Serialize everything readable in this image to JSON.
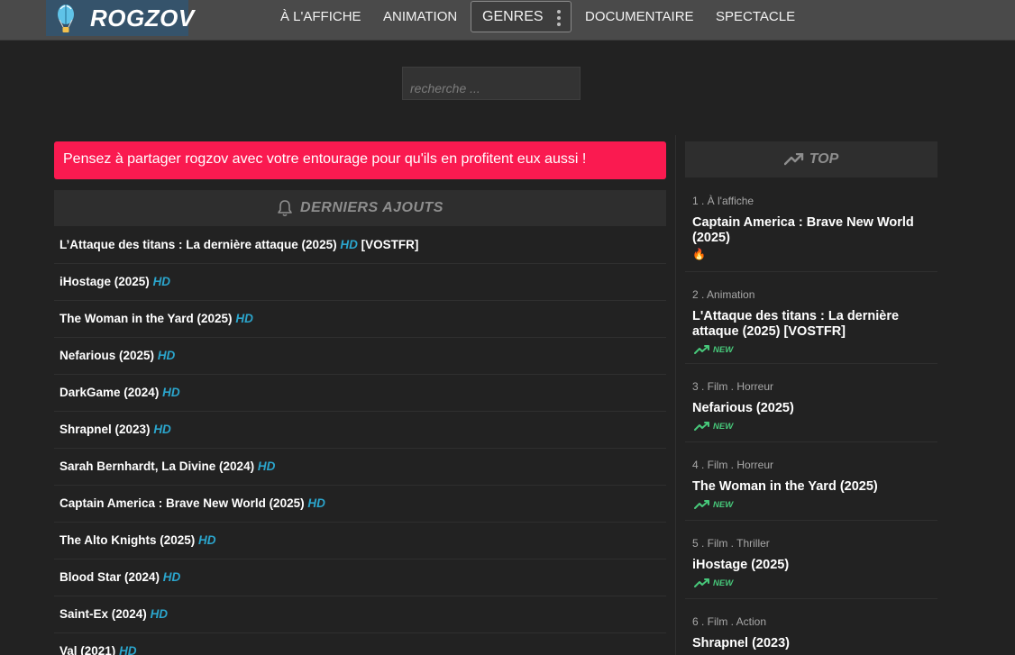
{
  "logo": {
    "text": "ROGZOV"
  },
  "nav": {
    "items": [
      "À L'AFFICHE",
      "ANIMATION",
      "DOCUMENTAIRE",
      "SPECTACLE"
    ],
    "genres_label": "GENRES"
  },
  "search": {
    "placeholder": "recherche ..."
  },
  "alert": {
    "text": "Pensez à partager rogzov avec votre entourage pour qu'ils en profitent eux aussi !"
  },
  "latest": {
    "title": "DERNIERS AJOUTS",
    "items": [
      {
        "title": "L’Attaque des titans : La dernière attaque (2025)",
        "quality": "HD",
        "extra": "[VOSTFR]"
      },
      {
        "title": "iHostage (2025)",
        "quality": "HD",
        "extra": ""
      },
      {
        "title": "The Woman in the Yard (2025)",
        "quality": "HD",
        "extra": ""
      },
      {
        "title": "Nefarious (2025)",
        "quality": "HD",
        "extra": ""
      },
      {
        "title": "DarkGame (2024)",
        "quality": "HD",
        "extra": ""
      },
      {
        "title": "Shrapnel (2023)",
        "quality": "HD",
        "extra": ""
      },
      {
        "title": "Sarah Bernhardt, La Divine (2024)",
        "quality": "HD",
        "extra": ""
      },
      {
        "title": "Captain America : Brave New World (2025)",
        "quality": "HD",
        "extra": ""
      },
      {
        "title": "The Alto Knights (2025)",
        "quality": "HD",
        "extra": ""
      },
      {
        "title": "Blood Star (2024)",
        "quality": "HD",
        "extra": ""
      },
      {
        "title": "Saint-Ex (2024)",
        "quality": "HD",
        "extra": ""
      },
      {
        "title": "Val (2021)",
        "quality": "HD",
        "extra": ""
      }
    ]
  },
  "top": {
    "title": "TOP",
    "items": [
      {
        "category": "1 . À l'affiche",
        "title": "Captain America : Brave New World (2025)",
        "badge": "fire",
        "badge_text": "🔥"
      },
      {
        "category": "2 . Animation",
        "title": "L'Attaque des titans : La dernière attaque (2025) [VOSTFR]",
        "badge": "new",
        "badge_text": "NEW"
      },
      {
        "category": "3 . Film . Horreur",
        "title": "Nefarious (2025)",
        "badge": "new",
        "badge_text": "NEW"
      },
      {
        "category": "4 . Film . Horreur",
        "title": "The Woman in the Yard (2025)",
        "badge": "new",
        "badge_text": "NEW"
      },
      {
        "category": "5 . Film . Thriller",
        "title": "iHostage (2025)",
        "badge": "new",
        "badge_text": "NEW"
      },
      {
        "category": "6 . Film . Action",
        "title": "Shrapnel (2023)",
        "badge": "",
        "badge_text": ""
      }
    ]
  },
  "colors": {
    "background": "#222222",
    "navbar": "#4a4a4a",
    "logo_bg": "#35536b",
    "alert": "#fa1a50",
    "hd": "#2ba5cc",
    "new": "#47c87a"
  }
}
